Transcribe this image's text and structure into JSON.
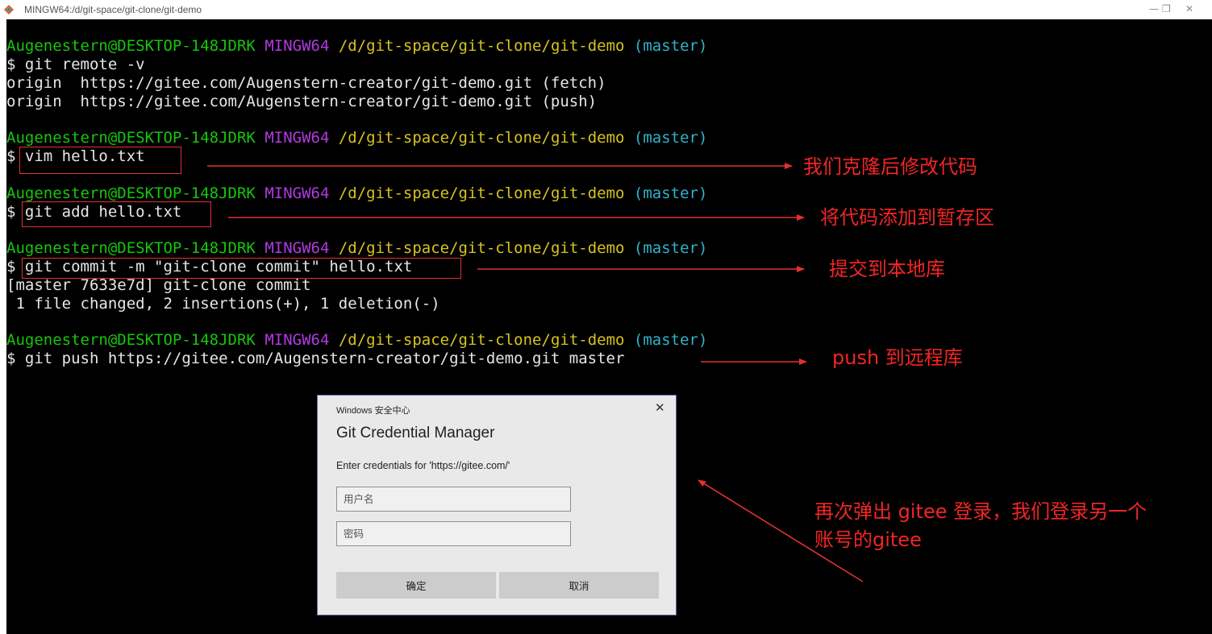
{
  "window": {
    "title": "MINGW64:/d/git-space/git-clone/git-demo",
    "minimize_glyph": "—",
    "restore_glyph": "❐",
    "close_glyph": "✕"
  },
  "terminal": {
    "prompt": {
      "user": "Augenestern@DESKTOP-148JDRK",
      "env": "MINGW64",
      "path": "/d/git-space/git-clone/git-demo",
      "branch": "(master)"
    },
    "dollar": "$",
    "commands": [
      "git remote -v",
      "vim hello.txt",
      "git add hello.txt",
      "git commit -m \"git-clone commit\" hello.txt",
      "git push https://gitee.com/Augenstern-creator/git-demo.git master"
    ],
    "remote_output": [
      "origin  https://gitee.com/Augenstern-creator/git-demo.git (fetch)",
      "origin  https://gitee.com/Augenstern-creator/git-demo.git (push)"
    ],
    "commit_output": [
      "[master 7633e7d] git-clone commit",
      " 1 file changed, 2 insertions(+), 1 deletion(-)"
    ]
  },
  "annotations": {
    "clone_modify": "我们克隆后修改代码",
    "add_stage": "将代码添加到暂存区",
    "commit_local": "提交到本地库",
    "push_remote": "push 到远程库",
    "relogin_line1": "再次弹出 gitee 登录，我们登录另一个",
    "relogin_line2": "账号的gitee",
    "color": "#f22525"
  },
  "dialog": {
    "caption": "Windows 安全中心",
    "heading": "Git Credential Manager",
    "prompt": "Enter credentials for 'https://gitee.com/'",
    "username_placeholder": "用户名",
    "password_placeholder": "密码",
    "ok_label": "确定",
    "cancel_label": "取消",
    "close_glyph": "✕"
  }
}
